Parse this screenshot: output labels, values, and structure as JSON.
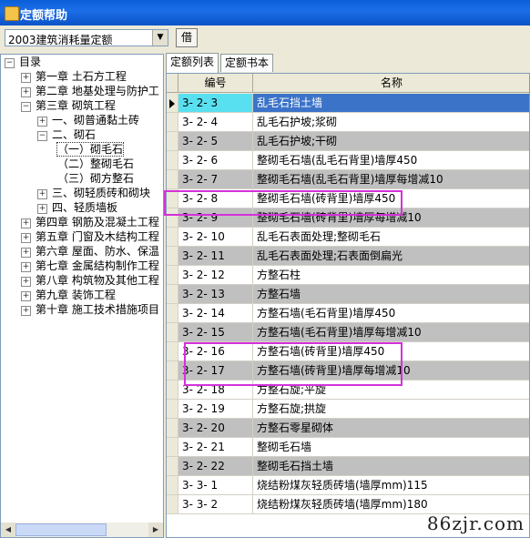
{
  "window": {
    "title": "定额帮助"
  },
  "toolbar": {
    "quota_select": "2003建筑消耗量定额",
    "borrow_label": "借"
  },
  "tree": [
    {
      "label": "目录",
      "level": 0,
      "expander": "−"
    },
    {
      "label": "第一章 土石方工程",
      "level": 1,
      "expander": "+"
    },
    {
      "label": "第二章 地基处理与防护工",
      "level": 1,
      "expander": "+"
    },
    {
      "label": "第三章 砌筑工程",
      "level": 1,
      "expander": "−"
    },
    {
      "label": "一、砌普通黏土砖",
      "level": 2,
      "expander": "+"
    },
    {
      "label": "二、砌石",
      "level": 2,
      "expander": "−"
    },
    {
      "label": "（一）砌毛石",
      "level": 3,
      "expander": "",
      "selected": true
    },
    {
      "label": "（二）整砌毛石",
      "level": 3,
      "expander": ""
    },
    {
      "label": "（三）砌方整石",
      "level": 3,
      "expander": ""
    },
    {
      "label": "三、砌轻质砖和砌块",
      "level": 2,
      "expander": "+"
    },
    {
      "label": "四、轻质墙板",
      "level": 2,
      "expander": "+"
    },
    {
      "label": "第四章 钢筋及混凝土工程",
      "level": 1,
      "expander": "+"
    },
    {
      "label": "第五章 门窗及木结构工程",
      "level": 1,
      "expander": "+"
    },
    {
      "label": "第六章 屋面、防水、保温",
      "level": 1,
      "expander": "+"
    },
    {
      "label": "第七章 金属结构制作工程",
      "level": 1,
      "expander": "+"
    },
    {
      "label": "第八章 构筑物及其他工程",
      "level": 1,
      "expander": "+"
    },
    {
      "label": "第九章 装饰工程",
      "level": 1,
      "expander": "+"
    },
    {
      "label": "第十章 施工技术措施项目",
      "level": 1,
      "expander": "+"
    }
  ],
  "tabs": [
    {
      "label": "定额列表"
    },
    {
      "label": "定额书本"
    }
  ],
  "grid": {
    "columns": [
      "编号",
      "名称"
    ],
    "rows": [
      {
        "code": "3- 2-  3",
        "name": "乱毛石挡土墙",
        "shade": "current"
      },
      {
        "code": "3- 2-  4",
        "name": "乱毛石护坡;浆砌",
        "shade": "white"
      },
      {
        "code": "3- 2-  5",
        "name": "乱毛石护坡;干砌",
        "shade": "gray"
      },
      {
        "code": "3- 2-  6",
        "name": "整砌毛石墙(乱毛石背里)墙厚450",
        "shade": "white"
      },
      {
        "code": "3- 2-  7",
        "name": "整砌毛石墙(乱毛石背里)墙厚每增减10",
        "shade": "gray"
      },
      {
        "code": "3- 2-  8",
        "name": "整砌毛石墙(砖背里)墙厚450",
        "shade": "white"
      },
      {
        "code": "3- 2-  9",
        "name": "整砌毛石墙(砖背里)墙厚每增减10",
        "shade": "gray"
      },
      {
        "code": "3- 2- 10",
        "name": "乱毛石表面处理;整砌毛石",
        "shade": "white"
      },
      {
        "code": "3- 2- 11",
        "name": "乱毛石表面处理;石表面倒扁光",
        "shade": "gray"
      },
      {
        "code": "3- 2- 12",
        "name": "方整石柱",
        "shade": "white"
      },
      {
        "code": "3- 2- 13",
        "name": "方整石墙",
        "shade": "gray"
      },
      {
        "code": "3- 2- 14",
        "name": "方整石墙(毛石背里)墙厚450",
        "shade": "white"
      },
      {
        "code": "3- 2- 15",
        "name": "方整石墙(毛石背里)墙厚每增减10",
        "shade": "gray"
      },
      {
        "code": "3- 2- 16",
        "name": "方整石墙(砖背里)墙厚450",
        "shade": "white"
      },
      {
        "code": "3- 2- 17",
        "name": "方整石墙(砖背里)墙厚每增减10",
        "shade": "gray"
      },
      {
        "code": "3- 2- 18",
        "name": "方整石旋;平旋",
        "shade": "white"
      },
      {
        "code": "3- 2- 19",
        "name": "方整石旋;拱旋",
        "shade": "white"
      },
      {
        "code": "3- 2- 20",
        "name": "方整石零星砌体",
        "shade": "gray"
      },
      {
        "code": "3- 2- 21",
        "name": "整砌毛石墙",
        "shade": "white"
      },
      {
        "code": "3- 2- 22",
        "name": "整砌毛石挡土墙",
        "shade": "gray"
      },
      {
        "code": "3- 3-  1",
        "name": "烧结粉煤灰轻质砖墙(墙厚mm)115",
        "shade": "white"
      },
      {
        "code": "3- 3-  2",
        "name": "烧结粉煤灰轻质砖墙(墙厚mm)180",
        "shade": "white"
      }
    ]
  },
  "watermark": "86zjr.com",
  "colors": {
    "title_bar": "#0b58d0",
    "current_code": "#59e0f0",
    "current_name": "#3b73c8",
    "highlight": "#d531d9",
    "row_gray": "#c0c0c0"
  }
}
